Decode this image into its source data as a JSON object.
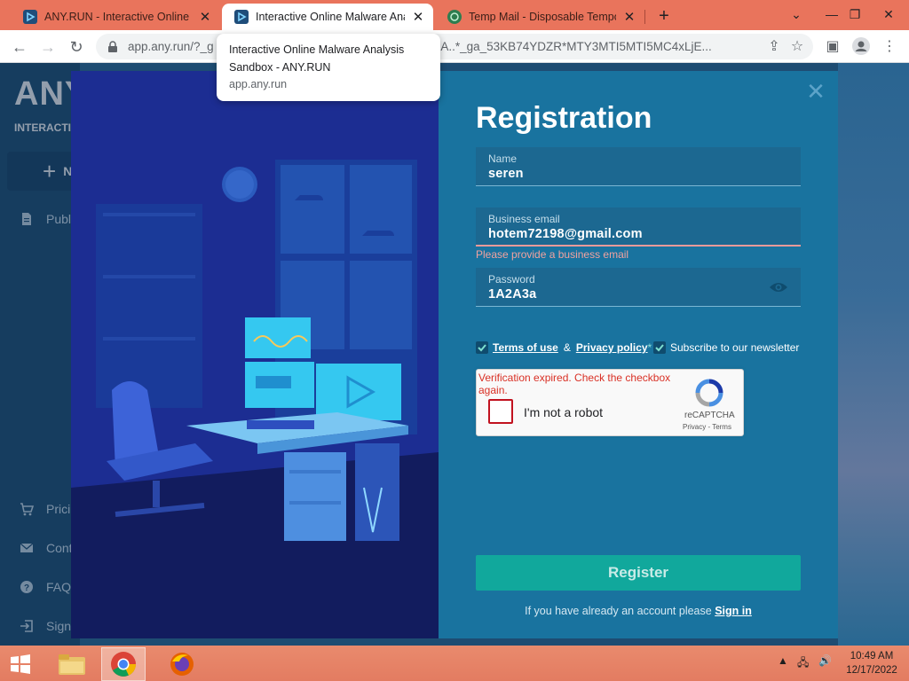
{
  "browser": {
    "tabs": [
      {
        "title": "ANY.RUN - Interactive Online Ma",
        "active": false
      },
      {
        "title": "Interactive Online Malware Analy",
        "active": true
      },
      {
        "title": "Temp Mail - Disposable Tempora",
        "active": false
      }
    ],
    "url": "app.any.run/?_g                                                       5MTI5MA..*_ga_53KB74YDZR*MTY3MTI5MTI5MC4xLjE...",
    "tooltip": {
      "title": "Interactive Online Malware Analysis Sandbox - ANY.RUN",
      "domain": "app.any.run"
    }
  },
  "sidebar": {
    "logo": "ANY.",
    "logo_sub": "INTERACTIVE I",
    "new_label": "N",
    "items": [
      {
        "label": "Publ",
        "icon": "document-icon"
      },
      {
        "label": "Prici",
        "icon": "cart-icon"
      },
      {
        "label": "Cont",
        "icon": "mail-icon"
      },
      {
        "label": "FAQ",
        "icon": "help-icon"
      },
      {
        "label": "Sign",
        "icon": "login-icon"
      }
    ]
  },
  "registration": {
    "title": "Registration",
    "name": {
      "label": "Name",
      "value": "seren"
    },
    "email": {
      "label": "Business email",
      "value": "hotem72198@gmail.com",
      "error": "Please provide a business email"
    },
    "password": {
      "label": "Password",
      "value": "1A2A3a"
    },
    "terms": {
      "terms_label": "Terms of use",
      "amp": "&",
      "privacy_label": "Privacy policy",
      "required_mark": "*",
      "checked": true
    },
    "newsletter": {
      "label": "Subscribe to our newsletter",
      "checked": true
    },
    "captcha": {
      "message": "Verification expired. Check the checkbox again.",
      "label": "I'm not a robot",
      "brand": "reCAPTCHA",
      "links": "Privacy - Terms"
    },
    "register_label": "Register",
    "signin_text": "If you have already an account please",
    "signin_link": "Sign in"
  },
  "taskbar": {
    "time": "10:49 AM",
    "date": "12/17/2022"
  },
  "colors": {
    "accent": "#11a89c",
    "form_bg": "#19739f",
    "illustration_bg": "#1c2d92",
    "error": "#d93025"
  }
}
